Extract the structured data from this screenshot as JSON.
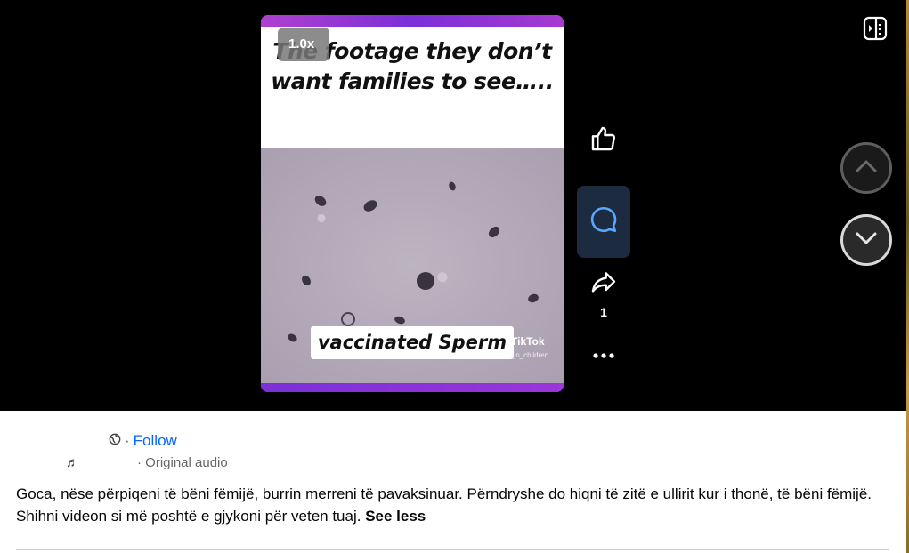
{
  "video": {
    "speed": "1.0x",
    "caption": "The footage they don’t want families to see…..",
    "overlay_label": "vaccinated Sperm",
    "watermark": "TikTok",
    "watermark_handle": "_in_children"
  },
  "actions": {
    "like_icon": "thumbs-up-icon",
    "comment_icon": "comment-icon",
    "share_icon": "share-icon",
    "share_count": "1",
    "more_icon": "more-icon"
  },
  "navigation": {
    "previous_icon": "chevron-up-icon",
    "next_icon": "chevron-down-icon",
    "pip_icon": "picture-in-picture-icon"
  },
  "post": {
    "author_name": "",
    "separator": "·",
    "follow_label": "Follow",
    "audio_label": "· Original audio",
    "description": "Goca, nëse përpiqeni të bëni fëmijë, burrin merreni të pavaksinuar. Përndryshe do hiqni të zitë e ullirit kur i thonë, të bëni fëmijë. Shihni videon si më poshtë e gjykoni për veten tuaj.",
    "see_less_label": "See less"
  },
  "colors": {
    "follow": "#0866ff",
    "active_button_bg": "#1c2b3f",
    "comment_icon": "#5aa7ff"
  }
}
